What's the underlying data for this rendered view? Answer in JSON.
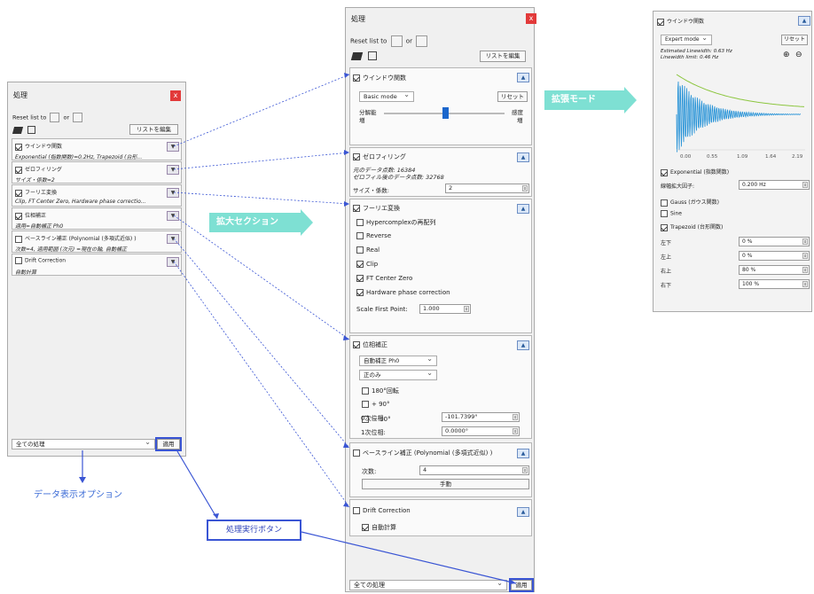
{
  "left_panel": {
    "title": "処理",
    "close": "x",
    "reset_label": "Reset list to",
    "or": "or",
    "edit_list": "リストを編集",
    "sections": [
      {
        "title": "ウインドウ関数",
        "summary": "Exponential (指数関数)=0.2Hz, Trapezoid (台形..."
      },
      {
        "title": "ゼロフィリング",
        "summary": "サイズ・係数=2"
      },
      {
        "title": "フーリエ変換",
        "summary": "Clip, FT Center Zero, Hardware phase correctio..."
      },
      {
        "title": "位相補正",
        "summary": "適用=自動補正 Ph0"
      },
      {
        "title": "ベースライン補正 (Polynomial (多項式近似) )",
        "summary": "次数=4, 適用範囲 (次元) =現在の軸, 自動補正"
      },
      {
        "title": "Drift Correction",
        "summary": "自動計算"
      }
    ],
    "bottom_select": "全ての処理",
    "apply": "適用"
  },
  "middle_panel": {
    "title": "処理",
    "close": "x",
    "reset_label": "Reset list to",
    "or": "or",
    "edit_list": "リストを編集",
    "window": {
      "title": "ウインドウ関数",
      "mode": "Basic mode",
      "reset": "リセット",
      "res_label_top": "分解能",
      "res_label_bot": "増",
      "sens_label_top": "感度",
      "sens_label_bot": "増"
    },
    "zerofill": {
      "title": "ゼロフィリング",
      "orig_points": "元のデータ点数: 16384",
      "zf_points": "ゼロフィル後のデータ点数: 32768",
      "size_label": "サイズ・係数:",
      "size_value": "2"
    },
    "ft": {
      "title": "フーリエ変換",
      "options": [
        {
          "label": "Hypercomplexの再配列",
          "checked": false
        },
        {
          "label": "Reverse",
          "checked": false
        },
        {
          "label": "Real",
          "checked": false
        },
        {
          "label": "Clip",
          "checked": true
        },
        {
          "label": "FT Center Zero",
          "checked": true
        },
        {
          "label": "Hardware phase correction",
          "checked": true
        }
      ],
      "scale_label": "Scale First Point:",
      "scale_value": "1.000"
    },
    "phase": {
      "title": "位相補正",
      "mode": "自動補正 Ph0",
      "sub": "正のみ",
      "opt1": "180°回転",
      "opt2": "+ 90°",
      "opt3": "－ 90°",
      "ph0_label": "0次位相:",
      "ph0_value": "-101.7399°",
      "ph1_label": "1次位相:",
      "ph1_value": "0.0000°"
    },
    "baseline": {
      "title": "ベースライン補正 (Polynomial (多項式近似) )",
      "order_label": "次数:",
      "order_value": "4",
      "manual": "手動"
    },
    "drift": {
      "title": "Drift Correction",
      "auto": "自動計算"
    },
    "bottom_select": "全ての処理",
    "apply": "適用"
  },
  "right_panel": {
    "title": "ウインドウ関数",
    "mode": "Expert mode",
    "reset": "リセット",
    "est_linewidth": "Estimated Linewidth: 0.63 Hz",
    "linewidth_limit": "Linewidth limit: 0.46 Hz",
    "x_ticks": [
      "0.00",
      "0.55",
      "1.09",
      "1.64",
      "2.19"
    ],
    "exponential": "Exponential (指数関数)",
    "broaden_label": "線幅拡大因子:",
    "broaden_value": "0.200 Hz",
    "gauss": "Gauss (ガウス関数)",
    "sine": "Sine",
    "trapezoid": "Trapezoid (台形関数)",
    "trap_rows": [
      {
        "label": "左下",
        "value": "0 %"
      },
      {
        "label": "左上",
        "value": "0 %"
      },
      {
        "label": "右上",
        "value": "80 %"
      },
      {
        "label": "右下",
        "value": "100 %"
      }
    ]
  },
  "annotations": {
    "expand_section": "拡大セクション",
    "expand_mode": "拡張モード",
    "data_display_option": "データ表示オプション",
    "process_button": "処理実行ボタン"
  },
  "colors": {
    "accent_blue": "#3a55d4",
    "arrow_teal": "#7ee0d3",
    "close_red": "#e23a3a",
    "fid_blue": "#1f8fd6",
    "window_green": "#8cc63f"
  }
}
